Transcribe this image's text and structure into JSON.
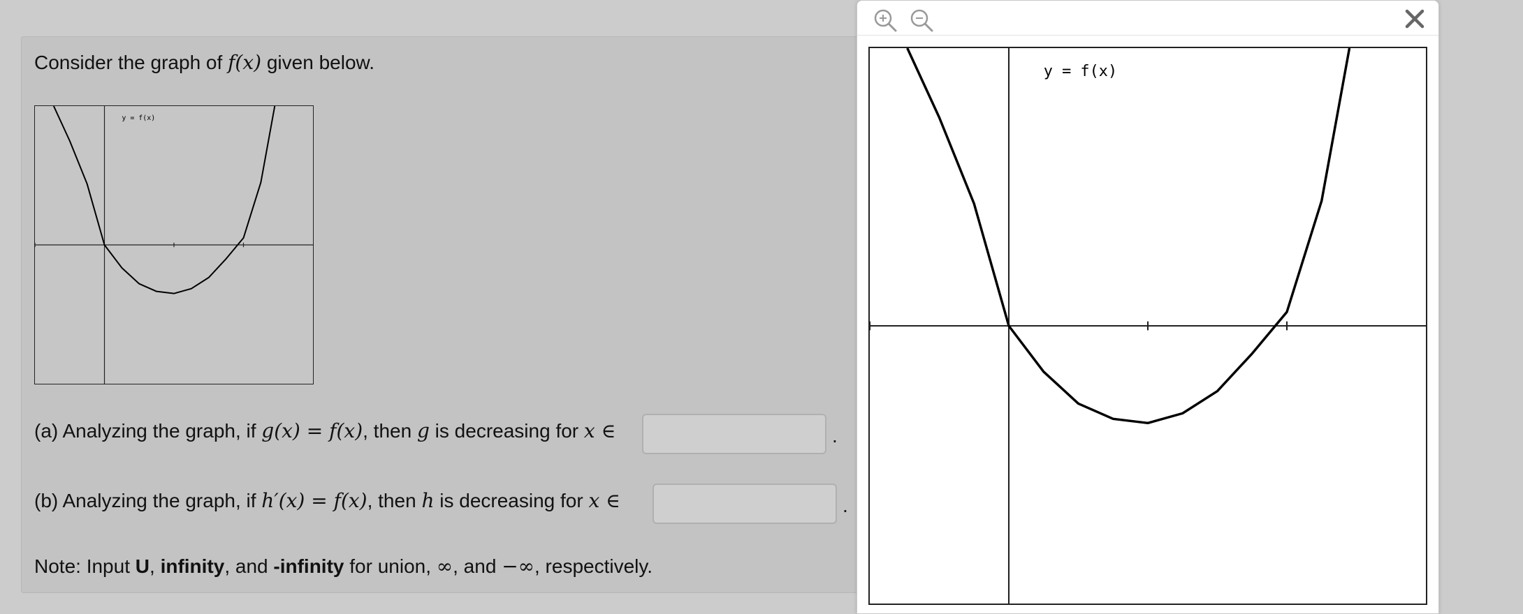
{
  "question": {
    "prompt_pre": "Consider the graph of ",
    "prompt_math": "f(x)",
    "prompt_post": " given below.",
    "part_a": {
      "label": "(a) Analyzing the graph, if ",
      "math_eq": "g(x) = f(x)",
      "mid": ", then ",
      "var": "g",
      "tail": " is decreasing for ",
      "domain_var": "x ∈",
      "answer_value": "",
      "period": "."
    },
    "part_b": {
      "label": "(b) Analyzing the graph, if ",
      "math_eq": "h′(x) = f(x)",
      "mid": ", then ",
      "var": "h",
      "tail": " is decreasing for ",
      "domain_var": "x ∈",
      "answer_value": "",
      "period": "."
    },
    "note": {
      "pre": "Note: Input ",
      "b1": "U",
      "s1": ", ",
      "b2": "infinity",
      "s2": ", and ",
      "b3": "-infinity",
      "s3": " for union, ",
      "inf": "∞",
      "s4": ", and ",
      "neg_inf": "−∞",
      "s5": ", respectively."
    }
  },
  "graph": {
    "label": "y = f(x)"
  },
  "popup": {
    "zoom_in_icon": "zoom-in-icon",
    "zoom_out_icon": "zoom-out-icon",
    "close_icon": "close-icon"
  },
  "chart_data": {
    "type": "line",
    "title": "y = f(x)",
    "xlabel": "",
    "ylabel": "",
    "xlim": [
      -1,
      3
    ],
    "ylim": [
      -2,
      2
    ],
    "x_ticks": [
      -1,
      1,
      2
    ],
    "grid": false,
    "series": [
      {
        "x": [
          -0.73,
          -0.5,
          -0.25,
          0,
          0.25,
          0.5,
          0.75,
          1,
          1.25,
          1.5,
          1.75,
          2,
          2.25,
          2.45
        ],
        "y": [
          2.0,
          1.5,
          0.88,
          0.0,
          -0.33,
          -0.56,
          -0.67,
          -0.7,
          -0.63,
          -0.47,
          -0.2,
          0.1,
          0.9,
          2.0
        ]
      }
    ]
  }
}
